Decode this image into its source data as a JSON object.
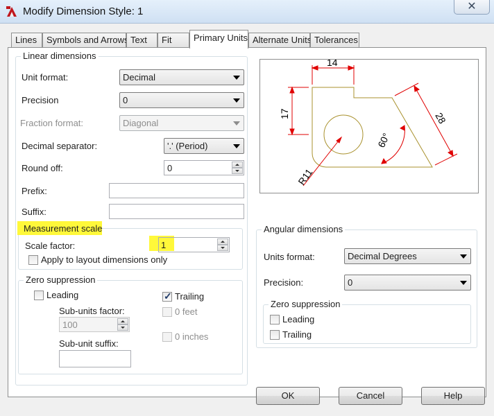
{
  "window": {
    "title": "Modify Dimension Style: 1",
    "close_glyph": "✕"
  },
  "tabs": [
    {
      "label": "Lines"
    },
    {
      "label": "Symbols and Arrows"
    },
    {
      "label": "Text"
    },
    {
      "label": "Fit"
    },
    {
      "label": "Primary Units"
    },
    {
      "label": "Alternate Units"
    },
    {
      "label": "Tolerances"
    }
  ],
  "active_tab": "Primary Units",
  "linear": {
    "group_label": "Linear dimensions",
    "unit_format_label": "Unit format:",
    "unit_format_value": "Decimal",
    "precision_label": "Precision",
    "precision_value": "0",
    "fraction_format_label": "Fraction format:",
    "fraction_format_value": "Diagonal",
    "decimal_separator_label": "Decimal separator:",
    "decimal_separator_value": "'.' (Period)",
    "round_off_label": "Round off:",
    "round_off_value": "0",
    "prefix_label": "Prefix:",
    "prefix_value": "",
    "suffix_label": "Suffix:",
    "suffix_value": ""
  },
  "measurement": {
    "group_label": "Measurement scale",
    "scale_factor_label": "Scale factor:",
    "scale_factor_value": "1",
    "apply_layout_label": "Apply to layout dimensions only",
    "apply_layout_checked": false,
    "highlight_color": "#fff83a"
  },
  "zero_suppression": {
    "group_label": "Zero suppression",
    "leading_label": "Leading",
    "leading_checked": false,
    "trailing_label": "Trailing",
    "trailing_checked": true,
    "sub_units_factor_label": "Sub-units factor:",
    "sub_units_factor_value": "100",
    "sub_unit_suffix_label": "Sub-unit suffix:",
    "sub_unit_suffix_value": "",
    "zero_feet_label": "0 feet",
    "zero_inches_label": "0 inches"
  },
  "preview": {
    "dim_top": "14",
    "dim_left": "17",
    "dim_diag": "28",
    "dim_angle": "60°",
    "dim_radius": "R11",
    "geometry_color": "#a8902c",
    "dimension_color": "#e00000"
  },
  "angular": {
    "group_label": "Angular dimensions",
    "units_format_label": "Units format:",
    "units_format_value": "Decimal Degrees",
    "precision_label": "Precision:",
    "precision_value": "0",
    "zero_group_label": "Zero suppression",
    "leading_label": "Leading",
    "leading_checked": false,
    "trailing_label": "Trailing",
    "trailing_checked": false
  },
  "buttons": {
    "ok": "OK",
    "cancel": "Cancel",
    "help": "Help"
  }
}
